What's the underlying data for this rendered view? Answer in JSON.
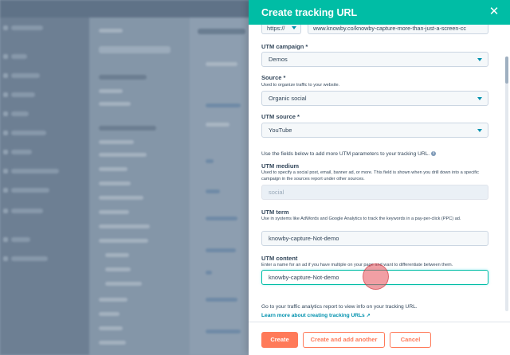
{
  "panel": {
    "title": "Create tracking URL",
    "close_glyph": "✕"
  },
  "url": {
    "protocol": "https://",
    "value": "www.knowby.co/knowby-capture-more-than-just-a-screen-cc"
  },
  "utm_campaign": {
    "label": "UTM campaign *",
    "value": "Demos"
  },
  "source": {
    "label": "Source *",
    "help": "Used to organize traffic to your website.",
    "value": "Organic social"
  },
  "utm_source": {
    "label": "UTM source *",
    "value": "YouTube"
  },
  "more_params_text": "Use the fields below to add more UTM parameters to your tracking URL.",
  "utm_medium": {
    "label": "UTM medium",
    "help": "Used to specify a social post, email, banner ad, or more. This field is shown when you drill down into a specific campaign in the sources report under other sources.",
    "value": "social"
  },
  "utm_term": {
    "label": "UTM term",
    "help": "Use in systems like AdWords and Google Analytics to track the keywords in a pay-per-click (PPC) ad.",
    "value": "knowby-capture-Not-demo"
  },
  "utm_content": {
    "label": "UTM content",
    "help": "Enter a name for an ad if you have multiple on your page and want to differentiate between them.",
    "value": "knowby-capture-Not-demo"
  },
  "footer_info": "Go to your traffic analytics report to view info on your tracking URL.",
  "learn_more": "Learn more about creating tracking URLs",
  "buttons": {
    "create": "Create",
    "create_another": "Create and add another",
    "cancel": "Cancel"
  },
  "colors": {
    "header": "#00bda5",
    "primary": "#ff7a59",
    "link": "#0091ae",
    "text": "#33475b"
  }
}
